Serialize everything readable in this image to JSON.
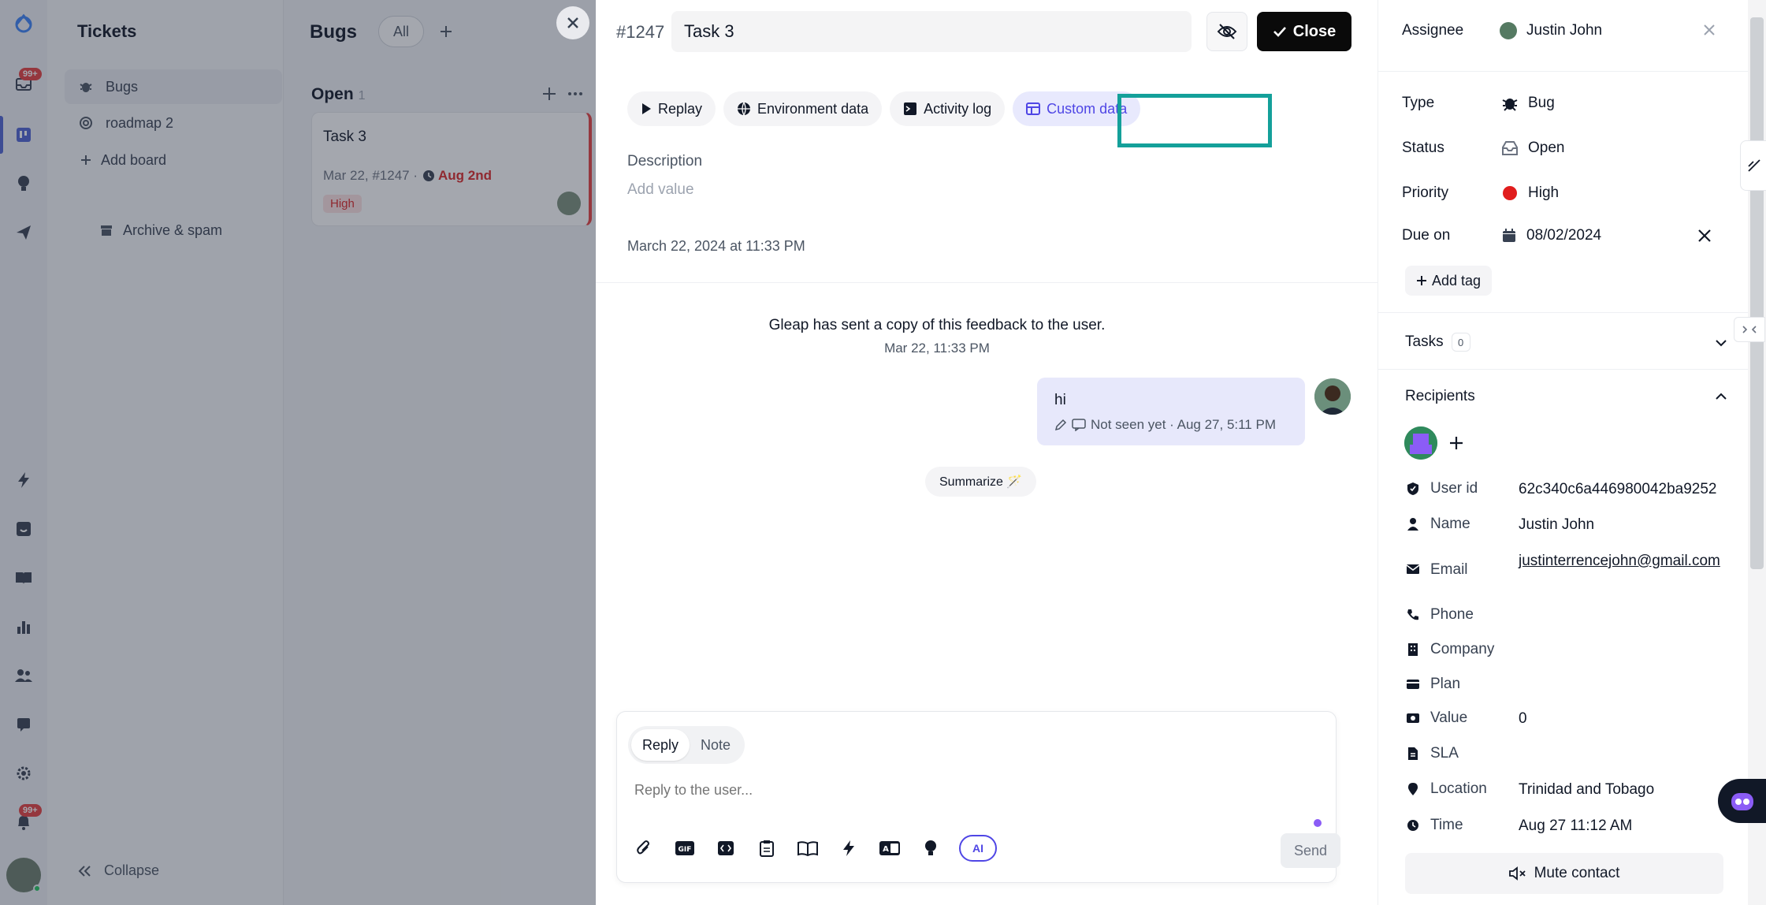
{
  "rail": {
    "inbox_badge": "99+",
    "notif_badge": "99+"
  },
  "sidebar": {
    "title": "Tickets",
    "boards": [
      {
        "label": "Bugs",
        "icon": "bug-icon",
        "active": true
      },
      {
        "label": "roadmap 2",
        "icon": "target-icon",
        "active": false
      }
    ],
    "add_board": "Add board",
    "archive": "Archive & spam",
    "collapse": "Collapse"
  },
  "board": {
    "title": "Bugs",
    "filter": "All",
    "column": {
      "name": "Open",
      "count": "1"
    },
    "card": {
      "title": "Task 3",
      "meta": "Mar 22, #1247 ·",
      "due": "Aug 2nd",
      "priority": "High"
    }
  },
  "detail": {
    "ticket_number": "#1247",
    "title": "Task 3",
    "close_label": "Close",
    "tabs": [
      {
        "label": "Replay",
        "icon": "play-icon",
        "active": false
      },
      {
        "label": "Environment data",
        "icon": "globe-icon",
        "active": false
      },
      {
        "label": "Activity log",
        "icon": "terminal-icon",
        "active": false
      },
      {
        "label": "Custom data",
        "icon": "table-icon",
        "active": true
      }
    ],
    "description_label": "Description",
    "description_placeholder": "Add value",
    "created_at": "March 22, 2024 at 11:33 PM",
    "system_message": "Gleap has sent a copy of this feedback to the user.",
    "system_time": "Mar 22, 11:33 PM",
    "message": {
      "text": "hi",
      "status": "Not seen yet · Aug 27, 5:11 PM"
    },
    "summarize": "Summarize 🪄",
    "composer": {
      "mode_reply": "Reply",
      "mode_note": "Note",
      "placeholder": "Reply to the user...",
      "send": "Send",
      "ai": "AI"
    }
  },
  "right": {
    "assignee_label": "Assignee",
    "assignee": "Justin John",
    "type_label": "Type",
    "type": "Bug",
    "status_label": "Status",
    "status": "Open",
    "priority_label": "Priority",
    "priority": "High",
    "priority_color": "#e11d1d",
    "due_label": "Due on",
    "due": "08/02/2024",
    "add_tag": "Add tag",
    "tasks_label": "Tasks",
    "tasks_count": "0",
    "recipients_label": "Recipients",
    "contact": {
      "user_id_label": "User id",
      "user_id": "62c340c6a446980042ba9252",
      "name_label": "Name",
      "name": "Justin John",
      "email_label": "Email",
      "email": "justinterrencejohn@gmail.com",
      "phone_label": "Phone",
      "company_label": "Company",
      "plan_label": "Plan",
      "value_label": "Value",
      "value": "0",
      "sla_label": "SLA",
      "location_label": "Location",
      "location": "Trinidad and Tobago",
      "time_label": "Time",
      "time": "Aug 27 11:12 AM"
    },
    "mute": "Mute contact"
  }
}
